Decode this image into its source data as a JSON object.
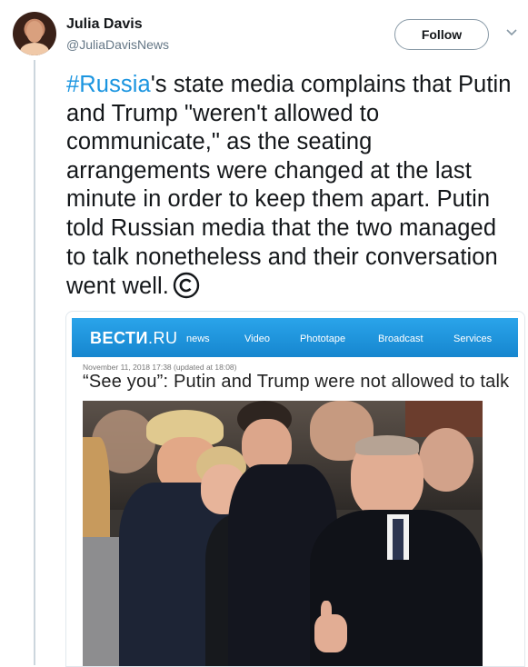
{
  "tweet": {
    "author_name": "Julia Davis",
    "author_handle": "@JuliaDavisNews",
    "follow_label": "Follow",
    "hashtag": "#Russia",
    "text_after_hashtag": "'s state media complains that Putin and Trump \"weren't allowed to communicate,\" as the seating arrangements were changed at the last minute in order to keep them apart. Putin told Russian media that the two managed to talk nonetheless and their conversation went well.",
    "end_icon": "copyright-icon"
  },
  "media": {
    "site_logo_bold": "ВЕСТИ",
    "site_logo_thin": ".RU",
    "nav": [
      "news",
      "Video",
      "Phototape",
      "Broadcast",
      "Services"
    ],
    "meta": "November 11, 2018   17:38   (updated at 18:08)",
    "headline": "“See you”: Putin and Trump were not allowed to talk",
    "header_color": "#1b95e0"
  },
  "colors": {
    "hashtag": "#1b95e0",
    "text": "#14171a",
    "secondary": "#657786"
  }
}
